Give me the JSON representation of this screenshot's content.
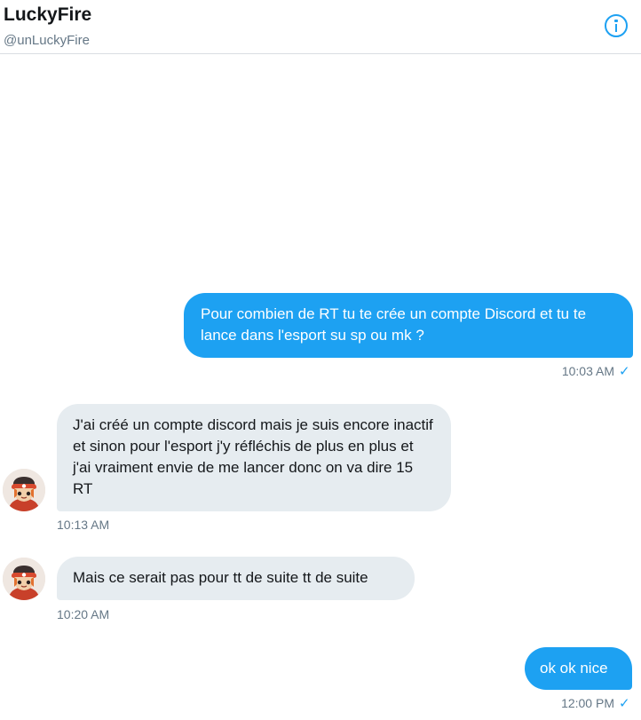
{
  "header": {
    "name": "LuckyFire",
    "handle": "@unLuckyFire",
    "info_icon": "info-icon"
  },
  "messages": [
    {
      "direction": "outgoing",
      "text": "Pour combien de RT tu te crée un compte Discord et tu te lance dans l'esport su sp ou mk ?",
      "time": "10:03 AM",
      "read_icon": "check-icon"
    },
    {
      "direction": "incoming",
      "text": "J'ai créé un compte discord mais je suis encore inactif et sinon pour l'esport j'y réfléchis de plus en plus et j'ai vraiment envie de me lancer donc on va dire 15 RT",
      "time": "10:13 AM",
      "avatar": "avatar-icon"
    },
    {
      "direction": "incoming",
      "text": "Mais ce serait pas pour tt de suite tt de suite",
      "time": "10:20 AM",
      "avatar": "avatar-icon"
    },
    {
      "direction": "outgoing",
      "text": "ok ok nice",
      "time": "12:00 PM",
      "read_icon": "check-icon"
    }
  ],
  "colors": {
    "accent": "#1da1f2",
    "incoming_bubble": "#e6ecf0",
    "secondary_text": "#657786"
  }
}
